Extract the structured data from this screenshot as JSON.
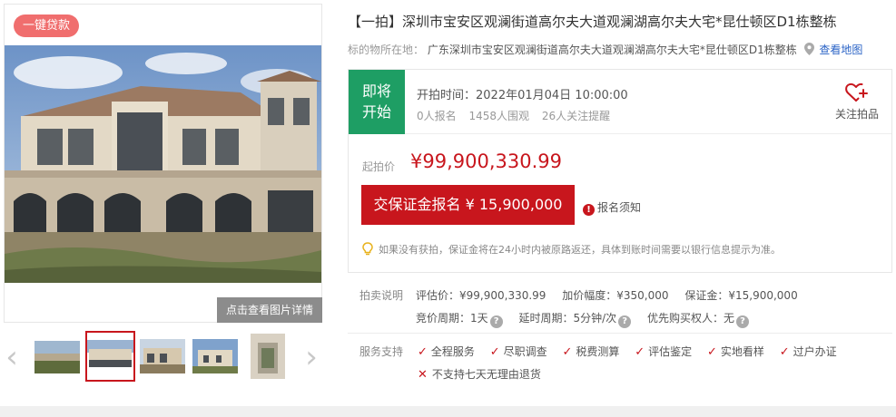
{
  "gallery": {
    "loan_badge": "一键贷款",
    "detail_button": "点击查看图片详情",
    "prev_arrow": "‹",
    "next_arrow": "›",
    "selected_thumb_index": 1
  },
  "title": "【一拍】深圳市宝安区观澜街道高尔夫大道观澜湖高尔夫大宅*昆仕顿区D1栋整栋",
  "location": {
    "label": "标的物所在地：",
    "address": "广东深圳市宝安区观澜街道高尔夫大道观澜湖高尔夫大宅*昆仕顿区D1栋整栋",
    "map_link": "查看地图"
  },
  "auction": {
    "status_badge_line1": "即将",
    "status_badge_line2": "开始",
    "start_time": "开拍时间：2022年01月04日 10:00:00",
    "stats": [
      "0人报名",
      "1458人围观",
      "26人关注提醒"
    ],
    "follow_label": "关注拍品",
    "price_label": "起拍价",
    "price_value": "¥99,900,330.99",
    "deposit_button": "交保证金报名 ¥ 15,900,000",
    "notice_link": "报名须知",
    "tip": "如果没有获拍，保证金将在24小时内被原路返还，具体到账时间需要以银行信息提示为准。"
  },
  "description": {
    "label": "拍卖说明",
    "row1": [
      "评估价：¥99,900,330.99",
      "加价幅度：¥350,000",
      "保证金：¥15,900,000"
    ],
    "row2": [
      "竞价周期：1天",
      "延时周期：5分钟/次",
      "优先购买权人：无"
    ]
  },
  "services": {
    "label": "服务支持",
    "items": [
      "全程服务",
      "尽职调查",
      "税费测算",
      "评估鉴定",
      "实地看样",
      "过户办证"
    ],
    "not_supported": "不支持七天无理由退货"
  },
  "colors": {
    "accent_red": "#c8161d",
    "status_green": "#1e9e64",
    "link_blue": "#2a63c6"
  }
}
